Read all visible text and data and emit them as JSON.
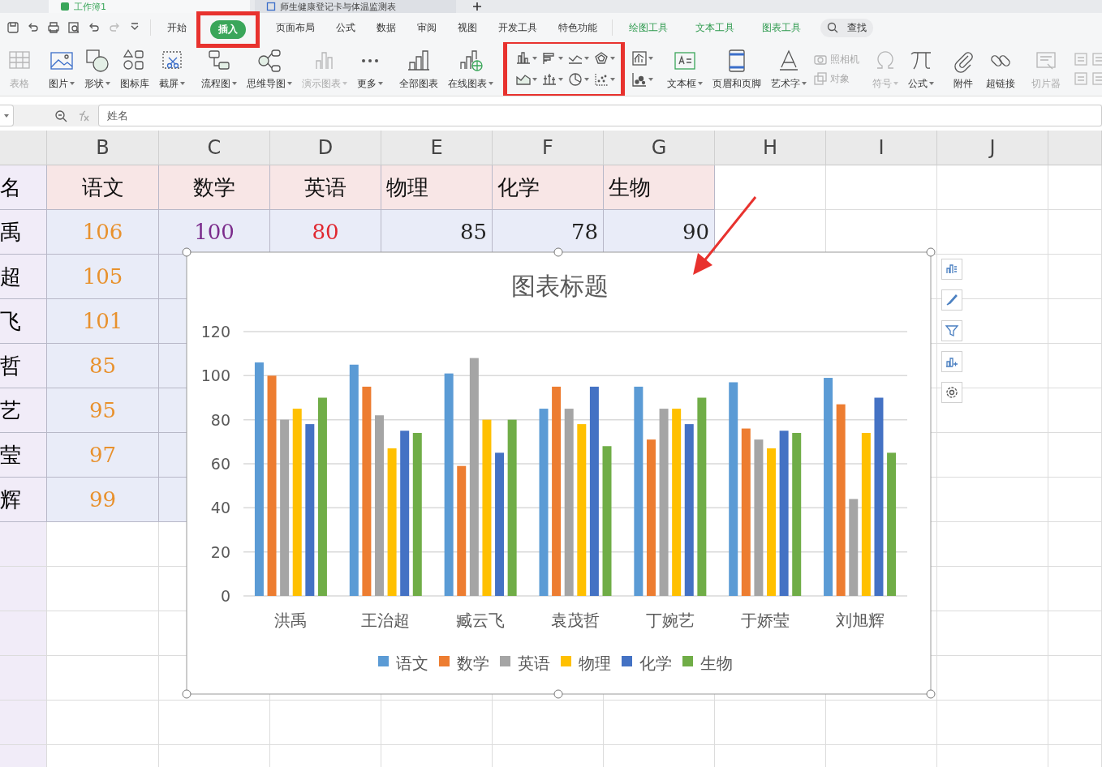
{
  "file_tabs": [
    {
      "label": "工作簿1",
      "selected": true
    },
    {
      "label": "师生健康登记卡与体温监测表",
      "selected": false
    }
  ],
  "menu_tabs": [
    {
      "label": "开始",
      "selected": false,
      "kind": "main"
    },
    {
      "label": "插入",
      "selected": true,
      "kind": "main"
    },
    {
      "label": "页面布局",
      "selected": false,
      "kind": "main"
    },
    {
      "label": "公式",
      "selected": false,
      "kind": "main"
    },
    {
      "label": "数据",
      "selected": false,
      "kind": "main"
    },
    {
      "label": "审阅",
      "selected": false,
      "kind": "main"
    },
    {
      "label": "视图",
      "selected": false,
      "kind": "main"
    },
    {
      "label": "开发工具",
      "selected": false,
      "kind": "main"
    },
    {
      "label": "特色功能",
      "selected": false,
      "kind": "main"
    },
    {
      "label": "绘图工具",
      "selected": false,
      "kind": "context"
    },
    {
      "label": "文本工具",
      "selected": false,
      "kind": "context"
    },
    {
      "label": "图表工具",
      "selected": false,
      "kind": "context"
    }
  ],
  "search": {
    "label": "查找"
  },
  "toolbar": {
    "groups": [
      {
        "items": [
          {
            "label": "表格",
            "kind": "large",
            "dropdown": false,
            "disabled": true
          }
        ]
      },
      {
        "items": [
          {
            "label": "图片",
            "kind": "large",
            "dropdown": true,
            "disabled": false
          },
          {
            "label": "形状",
            "kind": "large",
            "dropdown": true,
            "disabled": false
          },
          {
            "label": "图标库",
            "kind": "large",
            "dropdown": false,
            "disabled": false
          },
          {
            "label": "截屏",
            "kind": "large",
            "dropdown": true,
            "disabled": false
          }
        ]
      },
      {
        "items": [
          {
            "label": "流程图",
            "kind": "large",
            "dropdown": true,
            "disabled": false
          },
          {
            "label": "思维导图",
            "kind": "large",
            "dropdown": true,
            "disabled": false
          },
          {
            "label": "演示图表",
            "kind": "large",
            "dropdown": true,
            "disabled": true
          },
          {
            "label": "更多",
            "kind": "large",
            "dropdown": true,
            "disabled": false
          }
        ]
      },
      {
        "items": [
          {
            "label": "全部图表",
            "kind": "large",
            "dropdown": false,
            "disabled": false
          },
          {
            "label": "在线图表",
            "kind": "large",
            "dropdown": true,
            "disabled": false
          },
          {
            "kind": "chart_grid",
            "dropdown": true
          }
        ]
      },
      {
        "items": [
          {
            "label": "文本框",
            "kind": "large",
            "dropdown": true,
            "disabled": false
          },
          {
            "label": "页眉和页脚",
            "kind": "large",
            "dropdown": false,
            "disabled": false
          },
          {
            "label": "艺术字",
            "kind": "large",
            "dropdown": true,
            "disabled": false
          },
          {
            "label": "照相机",
            "kind": "small",
            "disabled": true
          },
          {
            "label": "对象",
            "kind": "small",
            "disabled": true
          }
        ]
      },
      {
        "items": [
          {
            "label": "符号",
            "kind": "large",
            "dropdown": true,
            "disabled": true
          },
          {
            "label": "公式",
            "kind": "large",
            "dropdown": true,
            "disabled": false
          }
        ]
      },
      {
        "items": [
          {
            "label": "附件",
            "kind": "large",
            "dropdown": false,
            "disabled": false
          },
          {
            "label": "超链接",
            "kind": "large",
            "dropdown": false,
            "disabled": false
          }
        ]
      },
      {
        "items": [
          {
            "label": "切片器",
            "kind": "large",
            "dropdown": false,
            "disabled": true
          }
        ]
      }
    ]
  },
  "formula_bar": {
    "value": "姓名"
  },
  "columns": [
    "B",
    "C",
    "D",
    "E",
    "F",
    "G",
    "H",
    "I",
    "J"
  ],
  "rows": [
    {
      "cells": [
        {
          "text": "名"
        },
        {
          "text": "语文"
        },
        {
          "text": "数学"
        },
        {
          "text": "英语"
        },
        {
          "text": "物理"
        },
        {
          "text": "化学"
        },
        {
          "text": "生物"
        }
      ]
    },
    {
      "cells": [
        {
          "text": "禹"
        },
        {
          "text": "106",
          "color": "#e8912d"
        },
        {
          "text": "100",
          "color": "#7b2c8c"
        },
        {
          "text": "80",
          "color": "#e0262f"
        },
        {
          "text": "85",
          "color": "#222222"
        },
        {
          "text": "78",
          "color": "#222222"
        },
        {
          "text": "90",
          "color": "#222222"
        }
      ]
    },
    {
      "cells": [
        {
          "text": "超"
        },
        {
          "text": "105",
          "color": "#e8912d"
        }
      ]
    },
    {
      "cells": [
        {
          "text": "飞"
        },
        {
          "text": "101",
          "color": "#e8912d"
        }
      ]
    },
    {
      "cells": [
        {
          "text": "哲"
        },
        {
          "text": "85",
          "color": "#e8912d"
        }
      ]
    },
    {
      "cells": [
        {
          "text": "艺"
        },
        {
          "text": "95",
          "color": "#e8912d"
        }
      ]
    },
    {
      "cells": [
        {
          "text": "莹"
        },
        {
          "text": "97",
          "color": "#e8912d"
        }
      ]
    },
    {
      "cells": [
        {
          "text": "辉"
        },
        {
          "text": "99",
          "color": "#e8912d"
        }
      ]
    }
  ],
  "chart": {
    "chart_data": {
      "type": "bar",
      "title": "图表标题",
      "categories": [
        "洪禹",
        "王治超",
        "臧云飞",
        "袁茂哲",
        "丁婉艺",
        "于娇莹",
        "刘旭辉"
      ],
      "series": [
        {
          "name": "语文",
          "color": "#5b9bd5",
          "values": [
            106,
            105,
            101,
            85,
            95,
            97,
            99
          ]
        },
        {
          "name": "数学",
          "color": "#ed7d31",
          "values": [
            100,
            95,
            59,
            95,
            71,
            76,
            87
          ]
        },
        {
          "name": "英语",
          "color": "#a5a5a5",
          "values": [
            80,
            82,
            108,
            85,
            85,
            71,
            44
          ]
        },
        {
          "name": "物理",
          "color": "#ffc000",
          "values": [
            85,
            67,
            80,
            78,
            85,
            67,
            74
          ]
        },
        {
          "name": "化学",
          "color": "#4472c4",
          "values": [
            78,
            75,
            65,
            95,
            78,
            75,
            90
          ]
        },
        {
          "name": "生物",
          "color": "#70ad47",
          "values": [
            90,
            74,
            80,
            68,
            90,
            74,
            65
          ]
        }
      ],
      "ylim": [
        0,
        120
      ],
      "grid": true,
      "legend": true,
      "yticks": [
        {
          "value": 0,
          "label": "0"
        },
        {
          "value": 20,
          "label": "20"
        },
        {
          "value": 40,
          "label": "40"
        },
        {
          "value": 60,
          "label": "60"
        },
        {
          "value": 80,
          "label": "80"
        },
        {
          "value": 100,
          "label": "100"
        },
        {
          "value": 120,
          "label": "120"
        }
      ]
    }
  }
}
